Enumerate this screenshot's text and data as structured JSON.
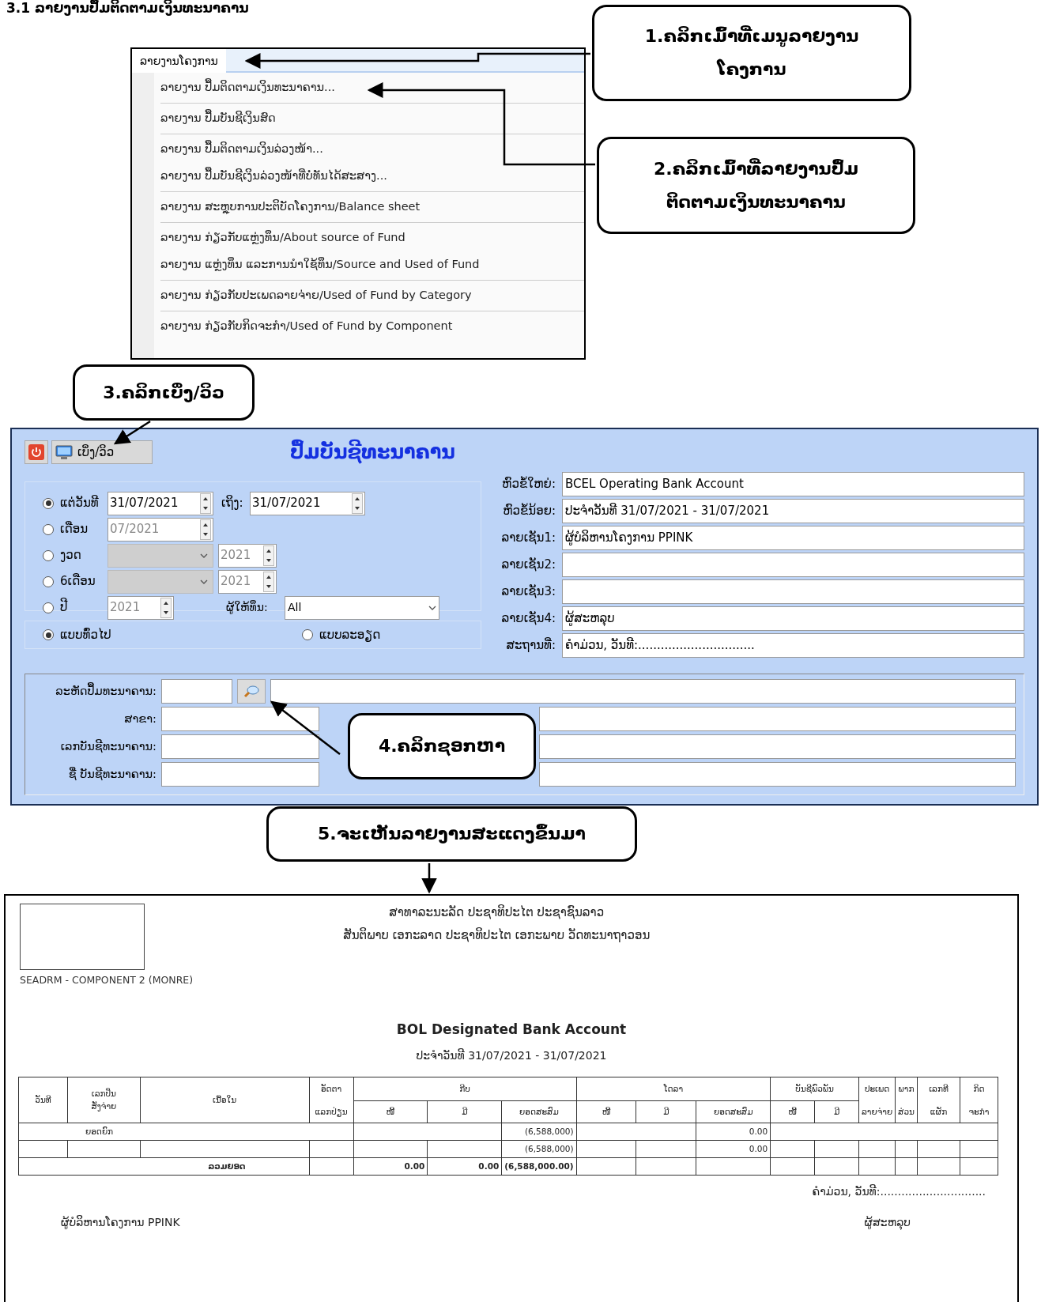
{
  "heading": "3.1 ລາຍງານປຶ້ມຕິດຕາມເງິນທະນາຄານ",
  "menu": {
    "title": "ລາຍງານໂຄງການ",
    "groups": [
      {
        "items": [
          "ລາຍງານ ປຶ້ມຕິດຕາມເງິນທະນາຄານ..."
        ]
      },
      {
        "items": [
          "ລາຍງານ ປຶ້ມບັນຊີເງິນສົດ"
        ]
      },
      {
        "items": [
          "ລາຍງານ ປຶ້ມຕິດຕາມເງິນລ່ວງໜ້າ...",
          "ລາຍງານ ປຶ້ມບັນຊີເງິນລ່ວງໜ້າທີ່ບໍ່ທັນໄດ້ສະສາງ..."
        ]
      },
      {
        "items": [
          "ລາຍງານ ສະຫຼຸບການປະຕິບັດໂຄງການ/Balance sheet"
        ]
      },
      {
        "items": [
          "ລາຍງານ ກ່ຽວກັບແຫຼ່ງທຶນ/About source of Fund",
          "ລາຍງານ ແຫຼ່ງທຶນ ແລະການນຳໃຊ້ທຶນ/Source and Used of Fund"
        ]
      },
      {
        "items": [
          "ລາຍງານ ກ່ຽວກັບປະເພດລາຍຈ່າຍ/Used of Fund by Category"
        ]
      },
      {
        "items": [
          "ລາຍງານ ກ່ຽວກັບກິດຈະກຳ/Used of Fund by Component"
        ]
      }
    ]
  },
  "callouts": [
    "1.ຄລິກເມົ້າທີ່ເມນູລາຍງານ\nໂຄງການ",
    "2.ຄລິກເມົ້າທີ່ລາຍງານປຶ້ມ\nຕິດຕາມເງິນທະນາຄານ",
    "3.ຄລິກເບິ່ງ/ວິວ",
    "4.ຄລິກຊອກຫາ",
    "5.ຈະເຫັນລາຍງານສະແດງຂຶ້ນມາ"
  ],
  "form": {
    "title": "ປຶ້ມບັນຊີທະນາຄານ",
    "view_button": "ເບິ່ງ/ວິວ",
    "periods": [
      {
        "kind": "range",
        "label": "ແຕ່ວັນທີ",
        "selected": true,
        "value": "31/07/2021",
        "to_label": "ເຖິງ:",
        "to_value": "31/07/2021"
      },
      {
        "kind": "month",
        "label": "ເດືອນ",
        "selected": false,
        "value": "07/2021"
      },
      {
        "kind": "combo",
        "label": "ງວດ",
        "selected": false,
        "value": "2021"
      },
      {
        "kind": "combo",
        "label": "6ເດືອນ",
        "selected": false,
        "value": "2021"
      },
      {
        "kind": "year",
        "label": "ປີ",
        "selected": false,
        "value": "2021",
        "donor_label": "ຜູ້ໃຫ້ທຶນ:",
        "donor_value": "All"
      }
    ],
    "styles": [
      {
        "label": "ແບບທົ່ວໄປ",
        "selected": true
      },
      {
        "label": "ແບບລະອຽດ",
        "selected": false
      }
    ],
    "headers": [
      {
        "label": "ຫົວຂໍ້ໃຫຍ່:",
        "value": "BCEL Operating Bank Account"
      },
      {
        "label": "ຫົວຂໍ້ນ້ອຍ:",
        "value": "ປະຈຳວັນທີ 31/07/2021 - 31/07/2021"
      },
      {
        "label": "ລາຍເຊັນ1:",
        "value": "ຜູ້ບໍລິຫານໂຄງການ PPINK"
      },
      {
        "label": "ລາຍເຊັນ2:"
      },
      {
        "label": "ລາຍເຊັນ3:"
      },
      {
        "label": "ລາຍເຊັນ4:",
        "value": "ຜູ້ສະຫລຸບ"
      },
      {
        "label": "ສະຖານທີ່:",
        "value": "ຄຳມ່ວນ, ວັນທີ:..............................."
      }
    ],
    "account_fields": [
      "ລະຫັດປຶ້ມທະນາຄານ:",
      "ສາຂາ:",
      "ເລກບັນຊີທະນາຄານ:",
      "ຊື່ ບັນຊີທະນາຄານ:"
    ]
  },
  "report": {
    "header_lines": [
      "ສາທາລະນະລັດ ປະຊາທິປະໄຕ ປະຊາຊົນລາວ",
      "ສັນຕິພາບ ເອກະລາດ ປະຊາທິປະໄຕ ເອກະພາບ ວັດທະນາຖາວອນ"
    ],
    "org": "SEADRM - COMPONENT 2 (MONRE)",
    "title": "BOL Designated Bank Account",
    "subtitle": "ປະຈຳວັນທີ 31/07/2021 - 31/07/2021",
    "table": {
      "groups": [
        {
          "label": "ວັນທີ"
        },
        {
          "label": "ເລກປິ່ນ\nສັ່ງຈ່າຍ"
        },
        {
          "label": "ເນື້ອໃນ"
        },
        {
          "label": "ອັດຕາ",
          "sub": [
            "ແລກປ່ຽນ"
          ]
        },
        {
          "label": "ກີບ",
          "sub": [
            "ໜີ້",
            "ມີ",
            "ຍອດສະສົມ"
          ]
        },
        {
          "label": "ໂດລາ",
          "sub": [
            "ໜີ້",
            "ມີ",
            "ຍອດສະສົມ"
          ]
        },
        {
          "label": "ບັນຊີພົວພັນ",
          "sub": [
            "ໜີ້",
            "ມີ"
          ]
        },
        {
          "label": "ປະເພດ",
          "sub": [
            "ລາຍຈ່າຍ"
          ]
        },
        {
          "label": "ພາກ",
          "sub": [
            "ສ່ວນ"
          ]
        },
        {
          "label": "ເລກທີ",
          "sub": [
            "ແຜັກ"
          ]
        },
        {
          "label": "ກິດ",
          "sub": [
            "ຈະກຳ"
          ]
        }
      ],
      "opening": {
        "label": "ຍອດຍົກ",
        "kip_balance": "(6,588,000)",
        "usd_balance": "0.00"
      },
      "rows": [
        {
          "kip_balance": "(6,588,000)",
          "usd_balance": "0.00"
        }
      ],
      "total": {
        "label": "ລວມຍອດ",
        "kip_debit": "0.00",
        "kip_credit": "0.00",
        "kip_balance": "(6,588,000.00)"
      }
    },
    "place_date": "ຄຳມ່ວນ, ວັນທີ:..............................",
    "signatures": [
      "ຜູ້ບໍລິຫານໂຄງການ PPINK",
      "ຜູ້ສະຫລຸບ"
    ]
  }
}
